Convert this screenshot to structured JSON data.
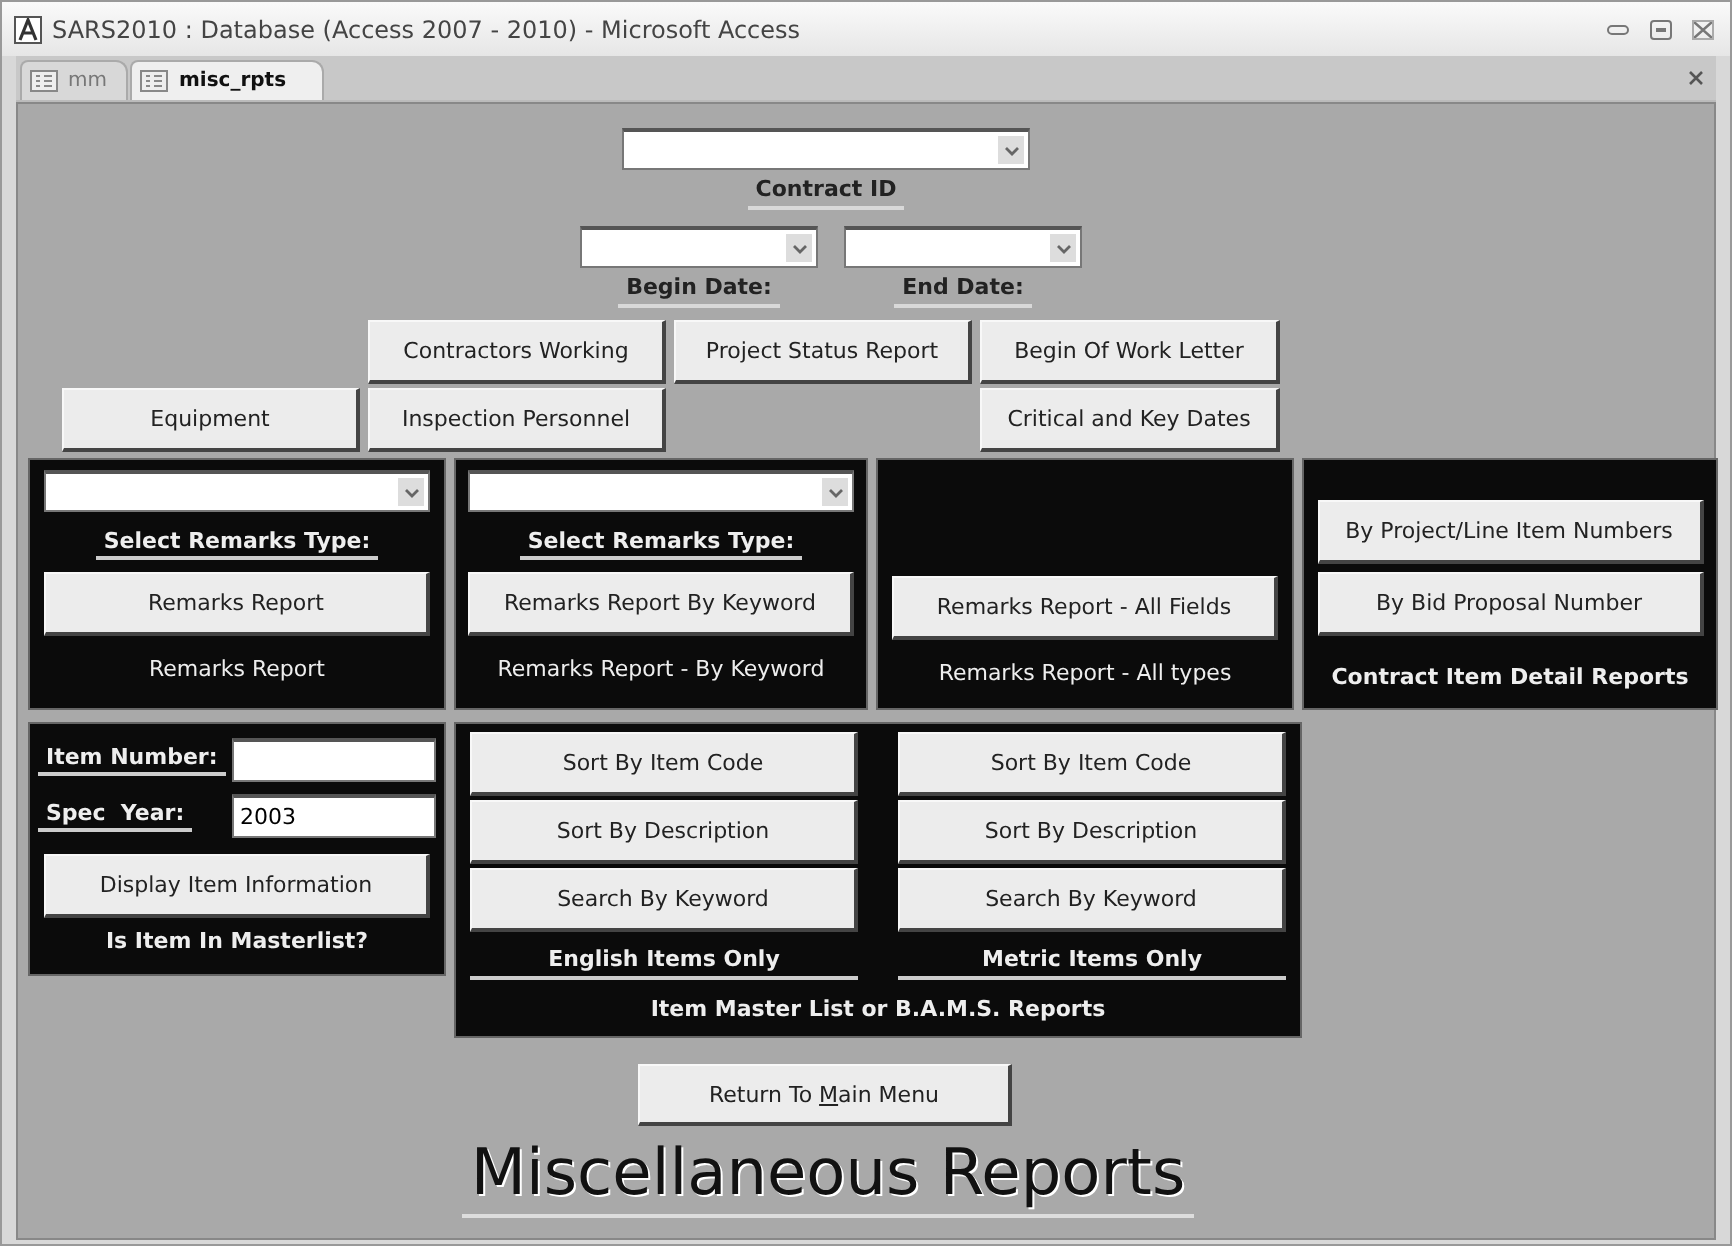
{
  "window": {
    "title": "SARS2010 : Database (Access 2007 - 2010) - Microsoft Access"
  },
  "tabs": [
    {
      "label": "mm",
      "selected": false
    },
    {
      "label": "misc_rpts",
      "selected": true
    }
  ],
  "contract_id": {
    "label": "Contract ID"
  },
  "begin_date": {
    "label": "Begin Date:"
  },
  "end_date": {
    "label": "End Date:"
  },
  "top_buttons": {
    "row_1": [
      "Contractors Working",
      "Project Status Report",
      "Begin Of Work Letter"
    ],
    "row_2": [
      "Equipment",
      "Inspection Personnel",
      "Critical and Key Dates"
    ]
  },
  "remarks_panels": [
    {
      "kind": "combo",
      "caption": "Select Remarks Type:",
      "button": "Remarks Report",
      "footer": "Remarks Report"
    },
    {
      "kind": "combo",
      "caption": "Select Remarks Type:",
      "button": "Remarks Report By Keyword",
      "footer": "Remarks Report - By Keyword"
    },
    {
      "kind": "plain",
      "button": "Remarks Report - All Fields",
      "footer": "Remarks Report - All types"
    }
  ],
  "contract_item_panel": {
    "buttons": [
      "By Project/Line Item Numbers",
      "By Bid Proposal Number"
    ],
    "footer": "Contract Item Detail Reports"
  },
  "item_panel": {
    "item_number": {
      "label": "Item Number:"
    },
    "spec_year": {
      "label": "Spec  Year:",
      "value": "2003"
    },
    "button": "Display Item Information",
    "footer": "Is Item In Masterlist?"
  },
  "master_list_panel": {
    "columns": [
      {
        "buttons": [
          "Sort By Item Code",
          "Sort By Description",
          "Search By Keyword"
        ],
        "caption": "English Items Only"
      },
      {
        "buttons": [
          "Sort By Item Code",
          "Sort By Description",
          "Search By Keyword"
        ],
        "caption": "Metric Items Only"
      }
    ],
    "footer": "Item Master List or B.A.M.S. Reports"
  },
  "return_button": {
    "before": "Return To ",
    "access_key": "M",
    "after": "ain Menu"
  },
  "title": "Miscellaneous Reports"
}
